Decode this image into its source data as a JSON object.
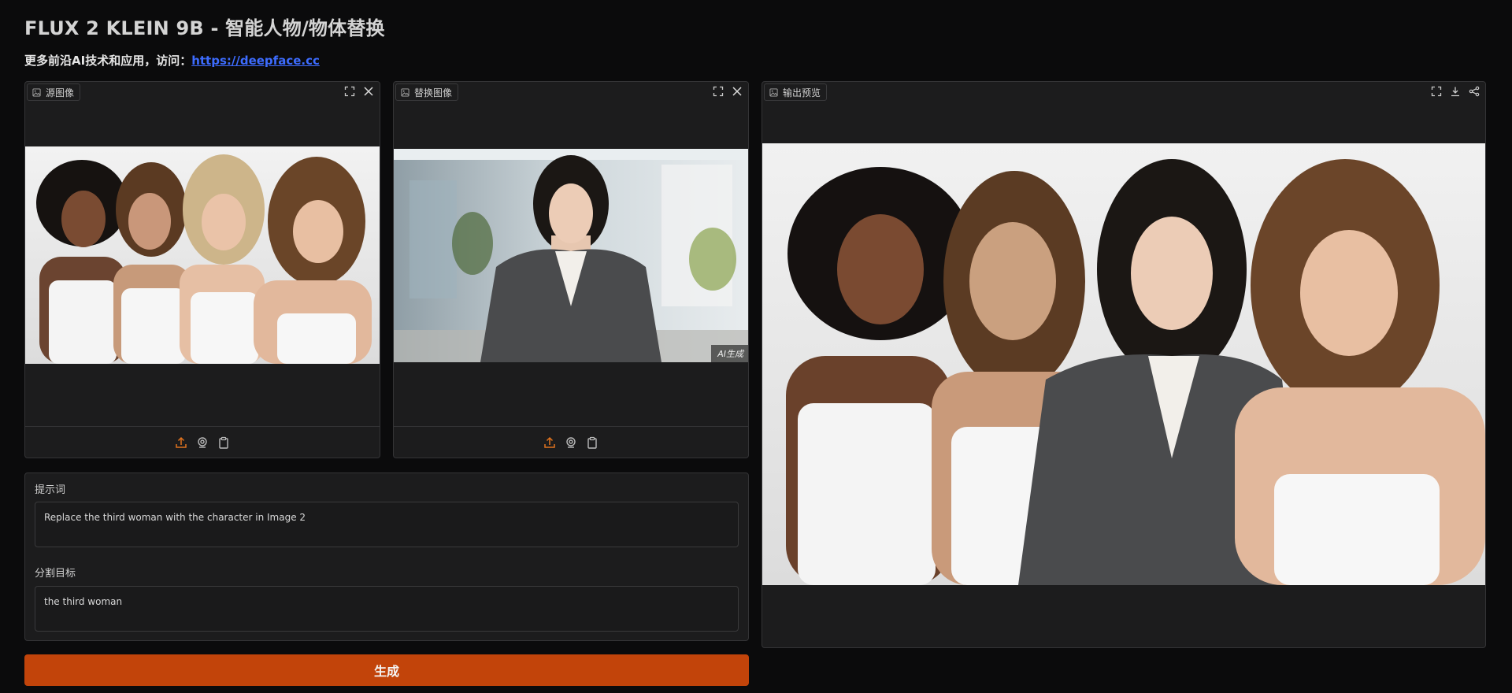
{
  "header": {
    "title": "FLUX 2 KLEIN 9B - 智能人物/物体替换",
    "subtitle_prefix": "更多前沿AI技术和应用，访问：",
    "subtitle_link": "https://deepface.cc"
  },
  "source_panel": {
    "label": "源图像",
    "label_icon": "image-icon",
    "actions": [
      "fullscreen-icon",
      "close-icon"
    ],
    "footer_actions": [
      "upload-icon",
      "webcam-icon",
      "clipboard-icon"
    ]
  },
  "replace_panel": {
    "label": "替换图像",
    "label_icon": "image-icon",
    "actions": [
      "fullscreen-icon",
      "close-icon"
    ],
    "badge": "AI生成",
    "footer_actions": [
      "upload-icon",
      "webcam-icon",
      "clipboard-icon"
    ]
  },
  "output_panel": {
    "label": "输出预览",
    "label_icon": "image-icon",
    "actions": [
      "fullscreen-icon",
      "download-icon",
      "share-icon"
    ]
  },
  "form": {
    "prompt_label": "提示词",
    "prompt_value": "Replace the third woman with the character in Image 2",
    "target_label": "分割目标",
    "target_value": "the third woman"
  },
  "generate_button": {
    "label": "生成"
  },
  "colors": {
    "accent": "#c2440a",
    "link": "#3d6cff",
    "background": "#0b0b0c",
    "panel": "#1c1c1d"
  }
}
